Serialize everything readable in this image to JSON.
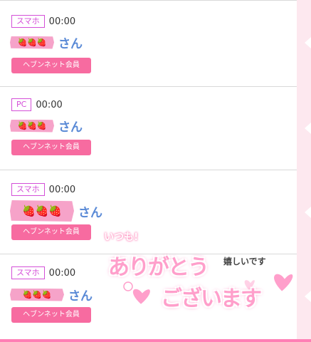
{
  "items": [
    {
      "device": "スマホ",
      "time": "00:00",
      "suffix": "さん",
      "button": "ヘブンネット会員",
      "berries": "🍓🍓🍓"
    },
    {
      "device": "PC",
      "time": "00:00",
      "suffix": "さん",
      "button": "ヘブンネット会員",
      "berries": "🍓🍓🍓"
    },
    {
      "device": "スマホ",
      "time": "00:00",
      "suffix": "さん",
      "button": "ヘブンネット会員",
      "berries": "🍓🍓🍓"
    },
    {
      "device": "スマホ",
      "time": "00:00",
      "suffix": "さん",
      "button": "ヘブンネット会員",
      "berries": "🍓🍓🍓"
    }
  ],
  "sticker": {
    "line1": "いつも!",
    "line2": "ありがとう",
    "line3": "ございます",
    "side": "嬉しいです"
  },
  "colors": {
    "badge": "#d44fd8",
    "button": "#f76ba0",
    "name_tag": "#f6a3c9",
    "name_text": "#5a8ad6",
    "side_panel": "#fde8ef",
    "bottom_bar": "#ff7fb5"
  }
}
